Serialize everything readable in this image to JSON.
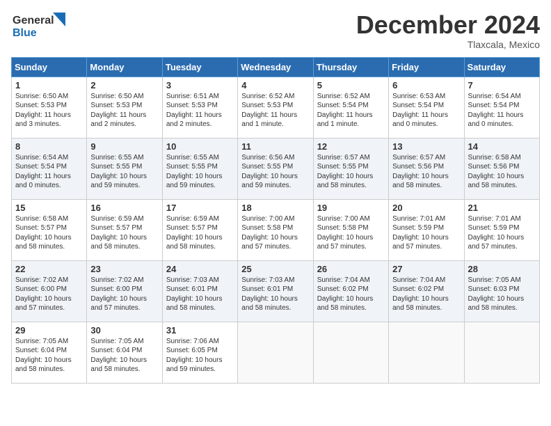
{
  "header": {
    "logo_line1": "General",
    "logo_line2": "Blue",
    "month": "December 2024",
    "location": "Tlaxcala, Mexico"
  },
  "weekdays": [
    "Sunday",
    "Monday",
    "Tuesday",
    "Wednesday",
    "Thursday",
    "Friday",
    "Saturday"
  ],
  "weeks": [
    [
      {
        "day": "1",
        "info": "Sunrise: 6:50 AM\nSunset: 5:53 PM\nDaylight: 11 hours\nand 3 minutes."
      },
      {
        "day": "2",
        "info": "Sunrise: 6:50 AM\nSunset: 5:53 PM\nDaylight: 11 hours\nand 2 minutes."
      },
      {
        "day": "3",
        "info": "Sunrise: 6:51 AM\nSunset: 5:53 PM\nDaylight: 11 hours\nand 2 minutes."
      },
      {
        "day": "4",
        "info": "Sunrise: 6:52 AM\nSunset: 5:53 PM\nDaylight: 11 hours\nand 1 minute."
      },
      {
        "day": "5",
        "info": "Sunrise: 6:52 AM\nSunset: 5:54 PM\nDaylight: 11 hours\nand 1 minute."
      },
      {
        "day": "6",
        "info": "Sunrise: 6:53 AM\nSunset: 5:54 PM\nDaylight: 11 hours\nand 0 minutes."
      },
      {
        "day": "7",
        "info": "Sunrise: 6:54 AM\nSunset: 5:54 PM\nDaylight: 11 hours\nand 0 minutes."
      }
    ],
    [
      {
        "day": "8",
        "info": "Sunrise: 6:54 AM\nSunset: 5:54 PM\nDaylight: 11 hours\nand 0 minutes."
      },
      {
        "day": "9",
        "info": "Sunrise: 6:55 AM\nSunset: 5:55 PM\nDaylight: 10 hours\nand 59 minutes."
      },
      {
        "day": "10",
        "info": "Sunrise: 6:55 AM\nSunset: 5:55 PM\nDaylight: 10 hours\nand 59 minutes."
      },
      {
        "day": "11",
        "info": "Sunrise: 6:56 AM\nSunset: 5:55 PM\nDaylight: 10 hours\nand 59 minutes."
      },
      {
        "day": "12",
        "info": "Sunrise: 6:57 AM\nSunset: 5:55 PM\nDaylight: 10 hours\nand 58 minutes."
      },
      {
        "day": "13",
        "info": "Sunrise: 6:57 AM\nSunset: 5:56 PM\nDaylight: 10 hours\nand 58 minutes."
      },
      {
        "day": "14",
        "info": "Sunrise: 6:58 AM\nSunset: 5:56 PM\nDaylight: 10 hours\nand 58 minutes."
      }
    ],
    [
      {
        "day": "15",
        "info": "Sunrise: 6:58 AM\nSunset: 5:57 PM\nDaylight: 10 hours\nand 58 minutes."
      },
      {
        "day": "16",
        "info": "Sunrise: 6:59 AM\nSunset: 5:57 PM\nDaylight: 10 hours\nand 58 minutes."
      },
      {
        "day": "17",
        "info": "Sunrise: 6:59 AM\nSunset: 5:57 PM\nDaylight: 10 hours\nand 58 minutes."
      },
      {
        "day": "18",
        "info": "Sunrise: 7:00 AM\nSunset: 5:58 PM\nDaylight: 10 hours\nand 57 minutes."
      },
      {
        "day": "19",
        "info": "Sunrise: 7:00 AM\nSunset: 5:58 PM\nDaylight: 10 hours\nand 57 minutes."
      },
      {
        "day": "20",
        "info": "Sunrise: 7:01 AM\nSunset: 5:59 PM\nDaylight: 10 hours\nand 57 minutes."
      },
      {
        "day": "21",
        "info": "Sunrise: 7:01 AM\nSunset: 5:59 PM\nDaylight: 10 hours\nand 57 minutes."
      }
    ],
    [
      {
        "day": "22",
        "info": "Sunrise: 7:02 AM\nSunset: 6:00 PM\nDaylight: 10 hours\nand 57 minutes."
      },
      {
        "day": "23",
        "info": "Sunrise: 7:02 AM\nSunset: 6:00 PM\nDaylight: 10 hours\nand 57 minutes."
      },
      {
        "day": "24",
        "info": "Sunrise: 7:03 AM\nSunset: 6:01 PM\nDaylight: 10 hours\nand 58 minutes."
      },
      {
        "day": "25",
        "info": "Sunrise: 7:03 AM\nSunset: 6:01 PM\nDaylight: 10 hours\nand 58 minutes."
      },
      {
        "day": "26",
        "info": "Sunrise: 7:04 AM\nSunset: 6:02 PM\nDaylight: 10 hours\nand 58 minutes."
      },
      {
        "day": "27",
        "info": "Sunrise: 7:04 AM\nSunset: 6:02 PM\nDaylight: 10 hours\nand 58 minutes."
      },
      {
        "day": "28",
        "info": "Sunrise: 7:05 AM\nSunset: 6:03 PM\nDaylight: 10 hours\nand 58 minutes."
      }
    ],
    [
      {
        "day": "29",
        "info": "Sunrise: 7:05 AM\nSunset: 6:04 PM\nDaylight: 10 hours\nand 58 minutes."
      },
      {
        "day": "30",
        "info": "Sunrise: 7:05 AM\nSunset: 6:04 PM\nDaylight: 10 hours\nand 58 minutes."
      },
      {
        "day": "31",
        "info": "Sunrise: 7:06 AM\nSunset: 6:05 PM\nDaylight: 10 hours\nand 59 minutes."
      },
      null,
      null,
      null,
      null
    ]
  ]
}
